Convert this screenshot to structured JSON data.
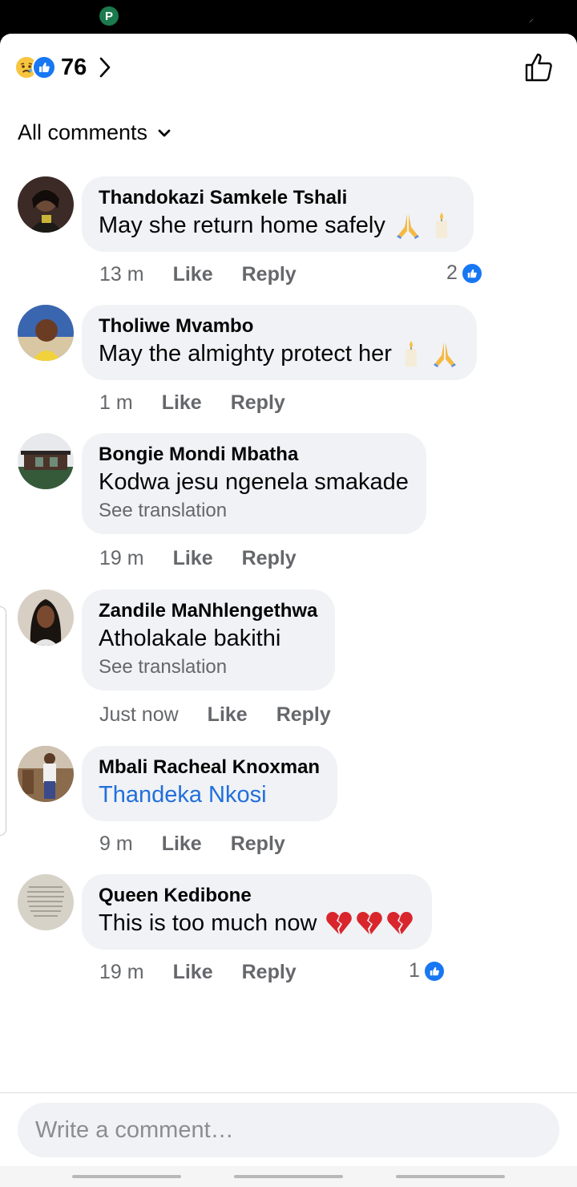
{
  "header": {
    "reaction_count": "76",
    "filter_label": "All comments"
  },
  "comments": [
    {
      "author": "Thandokazi Samkele Tshali",
      "text": "May she return home safely",
      "emojis": [
        "folded-hands",
        "candle"
      ],
      "time": "13 m",
      "like_label": "Like",
      "reply_label": "Reply",
      "reaction_count": "2"
    },
    {
      "author": "Tholiwe Mvambo",
      "text": "May the almighty protect her",
      "emojis": [
        "candle",
        "folded-hands"
      ],
      "time": "1 m",
      "like_label": "Like",
      "reply_label": "Reply"
    },
    {
      "author": "Bongie Mondi Mbatha",
      "text": "Kodwa jesu ngenela smakade",
      "translation": "See translation",
      "time": "19 m",
      "like_label": "Like",
      "reply_label": "Reply"
    },
    {
      "author": "Zandile MaNhlengethwa",
      "text": "Atholakale bakithi",
      "translation": "See translation",
      "time": "Just now",
      "like_label": "Like",
      "reply_label": "Reply"
    },
    {
      "author": "Mbali Racheal Knoxman",
      "text": "Thandeka Nkosi",
      "time": "9 m",
      "like_label": "Like",
      "reply_label": "Reply"
    },
    {
      "author": "Queen Kedibone",
      "text": "This is too much now",
      "emojis": [
        "broken-heart",
        "broken-heart",
        "broken-heart"
      ],
      "time": "19 m",
      "like_label": "Like",
      "reply_label": "Reply",
      "reaction_count": "1"
    }
  ],
  "composer": {
    "placeholder": "Write a comment…"
  },
  "colors": {
    "accent": "#1877f2",
    "mention": "#216fdb",
    "bubble": "#f0f2f5",
    "meta_text": "#65676b"
  }
}
